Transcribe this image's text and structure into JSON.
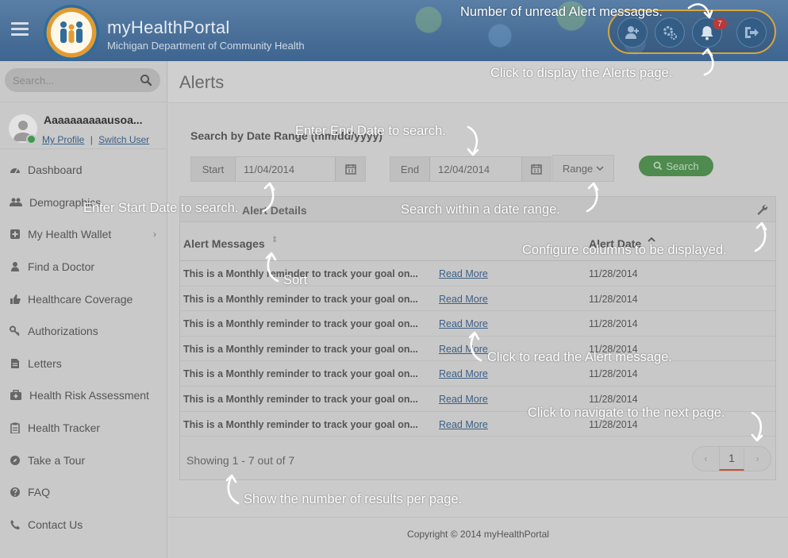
{
  "header": {
    "brand": "myHealthPortal",
    "subbrand": "Michigan Department of Community Health",
    "unread_count": "7",
    "accent": "#d7a63b"
  },
  "sidebar": {
    "search_placeholder": "Search...",
    "user_name": "Aaaaaaaaaausoa...",
    "my_profile": "My Profile",
    "separator": "|",
    "switch_user": "Switch User",
    "items": [
      {
        "label": "Dashboard",
        "icon": "dashboard-icon"
      },
      {
        "label": "Demographics",
        "icon": "users-icon"
      },
      {
        "label": "My Health Wallet",
        "icon": "plus-square-icon",
        "chevron": "›"
      },
      {
        "label": "Find a Doctor",
        "icon": "doctor-icon"
      },
      {
        "label": "Healthcare Coverage",
        "icon": "thumbs-up-icon"
      },
      {
        "label": "Authorizations",
        "icon": "key-icon"
      },
      {
        "label": "Letters",
        "icon": "document-icon"
      },
      {
        "label": "Health Risk Assessment",
        "icon": "medkit-icon"
      },
      {
        "label": "Health Tracker",
        "icon": "clipboard-icon"
      },
      {
        "label": "Take a Tour",
        "icon": "compass-icon"
      },
      {
        "label": "FAQ",
        "icon": "question-icon"
      },
      {
        "label": "Contact Us",
        "icon": "phone-icon"
      }
    ]
  },
  "main": {
    "title": "Alerts",
    "search_label": "Search by Date Range (mm/dd/yyyy)",
    "start_label": "Start",
    "start_value": "11/04/2014",
    "end_label": "End",
    "end_value": "12/04/2014",
    "range_label": "Range",
    "search_button": "Search",
    "panel_title": "Alert Details",
    "col_messages": "Alert Messages",
    "col_date": "Alert Date",
    "rows": [
      {
        "message": "This is a Monthly reminder to track your goal on...",
        "link": "Read More",
        "date": "11/28/2014"
      },
      {
        "message": "This is a Monthly reminder to track your goal on...",
        "link": "Read More",
        "date": "11/28/2014"
      },
      {
        "message": "This is a Monthly reminder to track your goal on...",
        "link": "Read More",
        "date": "11/28/2014"
      },
      {
        "message": "This is a Monthly reminder to track your goal on...",
        "link": "Read More",
        "date": "11/28/2014"
      },
      {
        "message": "This is a Monthly reminder to track your goal on...",
        "link": "Read More",
        "date": "11/28/2014"
      },
      {
        "message": "This is a Monthly reminder to track your goal on...",
        "link": "Read More",
        "date": "11/28/2014"
      },
      {
        "message": "This is a Monthly reminder to track your goal on...",
        "link": "Read More",
        "date": "11/28/2014"
      }
    ],
    "showing": "Showing 1 - 7 out of 7",
    "pager_prev": "‹",
    "pager_current": "1",
    "pager_next": "›"
  },
  "footer": {
    "copyright": "Copyright © 2014 myHealthPortal"
  },
  "annotations": {
    "unread": "Number of unread Alert messages.",
    "alerts_page": "Click to display the Alerts page.",
    "end_date": "Enter End Date to search.",
    "start_date": "Enter Start Date to search.",
    "range": "Search within a date range.",
    "configure": "Configure columns to be displayed.",
    "sort": "Sort",
    "read_msg": "Click to read the Alert message.",
    "next_page": "Click to navigate to the next page.",
    "results": "Show the number of results per page."
  }
}
